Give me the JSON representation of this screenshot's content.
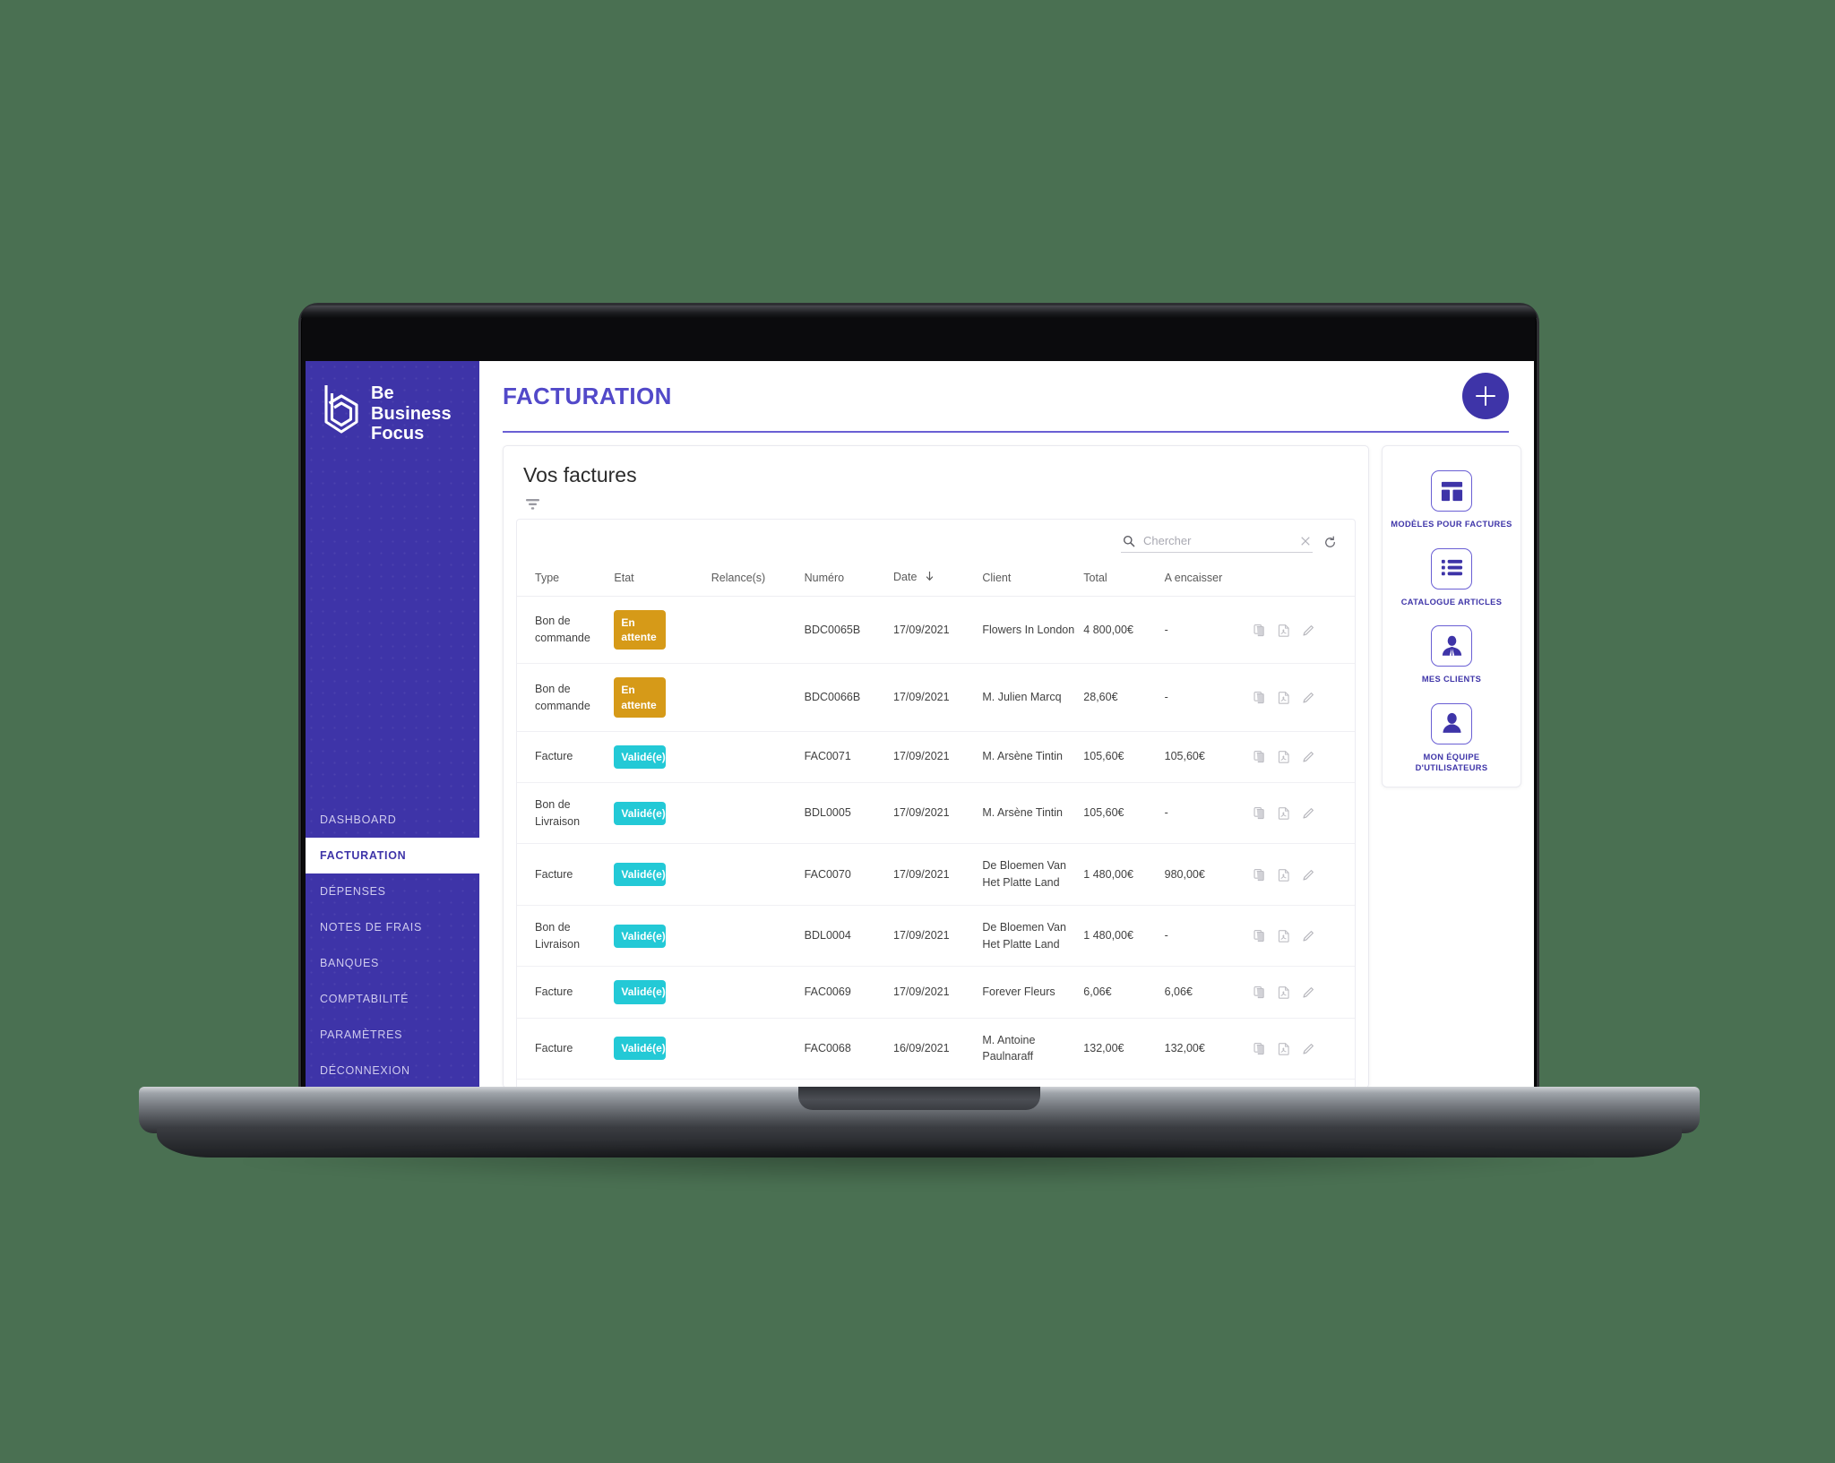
{
  "brand": {
    "line1": "Be",
    "line2": "Business",
    "line3": "Focus",
    "logo_icon": "bbf-hexagon-b-logo",
    "color": "#3e34a8"
  },
  "sidebar": {
    "items": [
      {
        "label": "DASHBOARD",
        "active": false
      },
      {
        "label": "FACTURATION",
        "active": true
      },
      {
        "label": "DÉPENSES",
        "active": false
      },
      {
        "label": "NOTES DE FRAIS",
        "active": false
      },
      {
        "label": "BANQUES",
        "active": false
      },
      {
        "label": "COMPTABILITÉ",
        "active": false
      },
      {
        "label": "PARAMÈTRES",
        "active": false
      },
      {
        "label": "DÉCONNEXION",
        "active": false
      }
    ]
  },
  "topbar": {
    "title": "FACTURATION",
    "add_button_icon": "plus-icon",
    "accent": "#5249c9"
  },
  "card": {
    "title": "Vos factures",
    "filter_icon": "filter-icon"
  },
  "search": {
    "placeholder": "Chercher",
    "value": "",
    "search_icon": "search-icon",
    "clear_icon": "close-icon",
    "refresh_icon": "refresh-icon"
  },
  "table": {
    "columns": [
      "Type",
      "Etat",
      "Relance(s)",
      "Numéro",
      "Date",
      "Client",
      "Total",
      "A encaisser",
      ""
    ],
    "sorted_column": "Date",
    "sort_direction": "desc",
    "row_actions": [
      "copy-icon",
      "pdf-icon",
      "edit-icon"
    ],
    "rows": [
      {
        "type": "Bon de commande",
        "etat": "En attente",
        "etat_style": "wait",
        "relances": "",
        "numero": "BDC0065B",
        "date": "17/09/2021",
        "client": "Flowers In London",
        "total": "4 800,00€",
        "a_encaisser": "-"
      },
      {
        "type": "Bon de commande",
        "etat": "En attente",
        "etat_style": "wait",
        "relances": "",
        "numero": "BDC0066B",
        "date": "17/09/2021",
        "client": "M. Julien Marcq",
        "total": "28,60€",
        "a_encaisser": "-"
      },
      {
        "type": "Facture",
        "etat": "Validé(e)",
        "etat_style": "valid",
        "relances": "",
        "numero": "FAC0071",
        "date": "17/09/2021",
        "client": "M. Arsène Tintin",
        "total": "105,60€",
        "a_encaisser": "105,60€"
      },
      {
        "type": "Bon de Livraison",
        "etat": "Validé(e)",
        "etat_style": "valid",
        "relances": "",
        "numero": "BDL0005",
        "date": "17/09/2021",
        "client": "M. Arsène Tintin",
        "total": "105,60€",
        "a_encaisser": "-"
      },
      {
        "type": "Facture",
        "etat": "Validé(e)",
        "etat_style": "valid",
        "relances": "",
        "numero": "FAC0070",
        "date": "17/09/2021",
        "client": "De Bloemen Van Het Platte Land",
        "total": "1 480,00€",
        "a_encaisser": "980,00€"
      },
      {
        "type": "Bon de Livraison",
        "etat": "Validé(e)",
        "etat_style": "valid",
        "relances": "",
        "numero": "BDL0004",
        "date": "17/09/2021",
        "client": "De Bloemen Van Het Platte Land",
        "total": "1 480,00€",
        "a_encaisser": "-"
      },
      {
        "type": "Facture",
        "etat": "Validé(e)",
        "etat_style": "valid",
        "relances": "",
        "numero": "FAC0069",
        "date": "17/09/2021",
        "client": "Forever Fleurs",
        "total": "6,06€",
        "a_encaisser": "6,06€"
      },
      {
        "type": "Facture",
        "etat": "Validé(e)",
        "etat_style": "valid",
        "relances": "",
        "numero": "FAC0068",
        "date": "16/09/2021",
        "client": "M. Antoine Paulnaraff",
        "total": "132,00€",
        "a_encaisser": "132,00€"
      }
    ]
  },
  "rail": {
    "items": [
      {
        "label": "MODÈLES POUR FACTURES",
        "icon": "layout-template-icon"
      },
      {
        "label": "CATALOGUE ARTICLES",
        "icon": "list-icon"
      },
      {
        "label": "MES CLIENTS",
        "icon": "business-person-icon"
      },
      {
        "label": "MON ÉQUIPE D'UTILISATEURS",
        "icon": "user-icon"
      }
    ]
  },
  "colors": {
    "brand_purple": "#3e34a8",
    "accent_purple": "#5249c9",
    "badge_pending": "#d69a18",
    "badge_valid": "#23c9d6",
    "page_background": "#4a7052"
  }
}
